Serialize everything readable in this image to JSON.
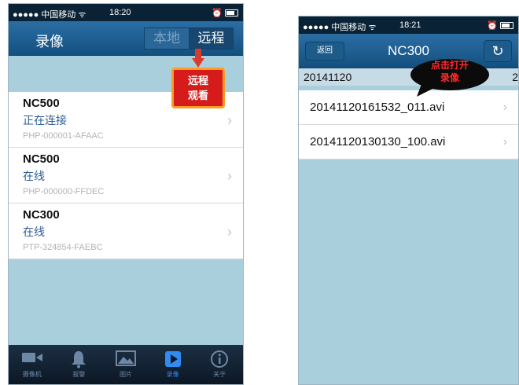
{
  "left_screen": {
    "status": {
      "carrier": "●●●●● 中国移动 ᯤ",
      "time": "18:20",
      "right": "⏰"
    },
    "nav": {
      "title": "录像",
      "tab_local": "本地",
      "tab_remote": "远程"
    },
    "callout": {
      "line1": "远程",
      "line2": "观看"
    },
    "devices": [
      {
        "name": "NC500",
        "status": "正在连接",
        "id": "PHP-000001-AFAAC"
      },
      {
        "name": "NC500",
        "status": "在线",
        "id": "PHP-000000-FFDEC"
      },
      {
        "name": "NC300",
        "status": "在线",
        "id": "PTP-324854-FAEBC"
      }
    ],
    "tabs": [
      {
        "label": "摄像机",
        "icon": "camera-icon"
      },
      {
        "label": "报警",
        "icon": "bell-icon"
      },
      {
        "label": "图片",
        "icon": "picture-icon"
      },
      {
        "label": "录像",
        "icon": "play-icon",
        "active": true
      },
      {
        "label": "关于",
        "icon": "info-icon"
      }
    ],
    "chevron": "›"
  },
  "right_screen": {
    "status": {
      "carrier": "●●●●● 中国移动 ᯤ",
      "time": "18:21",
      "right": "⏰"
    },
    "nav": {
      "back_label": "返回",
      "title": "NC300",
      "refresh_glyph": "↻"
    },
    "date": {
      "value": "20141120",
      "tail": "2"
    },
    "bubble": {
      "line1": "点击打开",
      "line2": "录像"
    },
    "files": [
      {
        "name": "20141120161532_011.avi"
      },
      {
        "name": "20141120130130_100.avi"
      }
    ],
    "chevron": "›"
  },
  "colors": {
    "nav_blue": "#1d5b8b",
    "background": "#a9cfdc",
    "status_link": "#2c5e9a",
    "callout_red": "#d61b1b",
    "callout_border": "#ff9a24",
    "tab_active": "#2f8cf0"
  }
}
